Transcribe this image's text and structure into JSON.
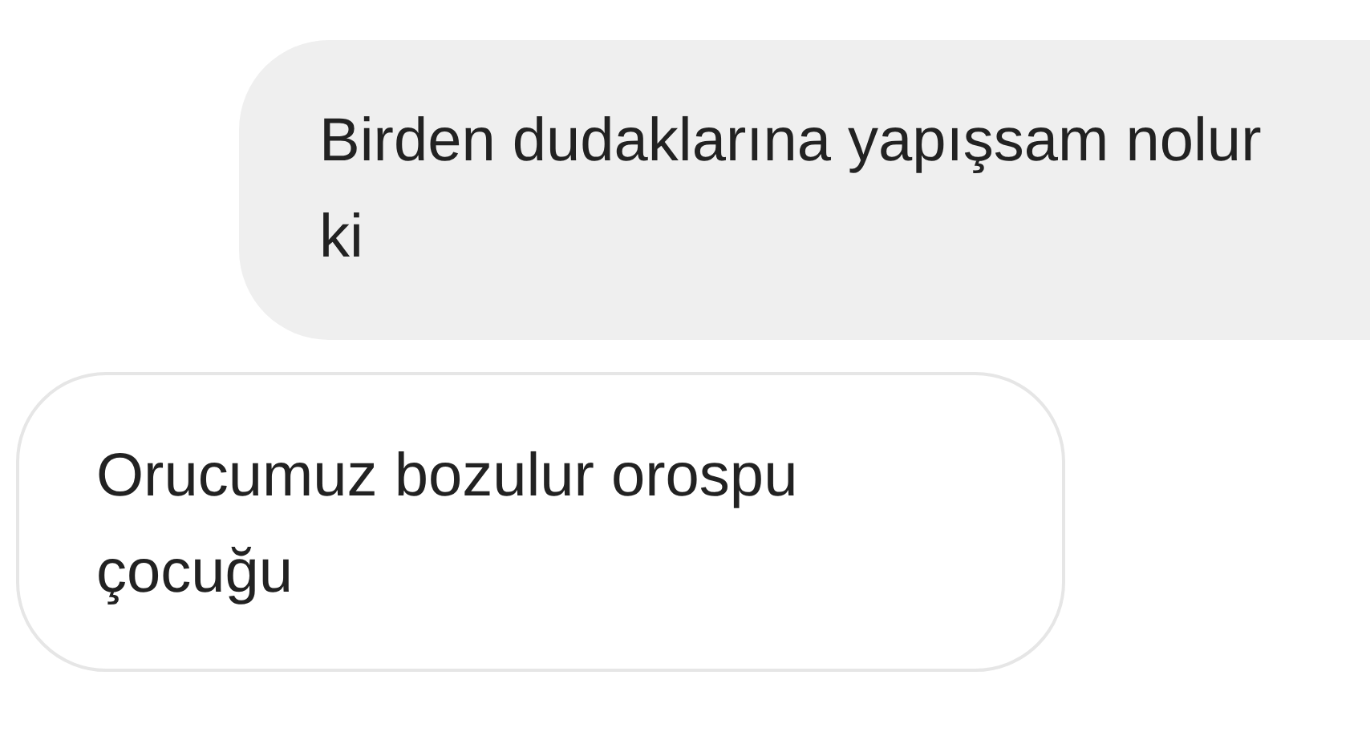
{
  "messages": [
    {
      "kind": "sent",
      "text": "Birden dudaklarına yapışsam nolur ki"
    },
    {
      "kind": "received",
      "text": "Orucumuz bozulur orospu çocuğu"
    }
  ]
}
